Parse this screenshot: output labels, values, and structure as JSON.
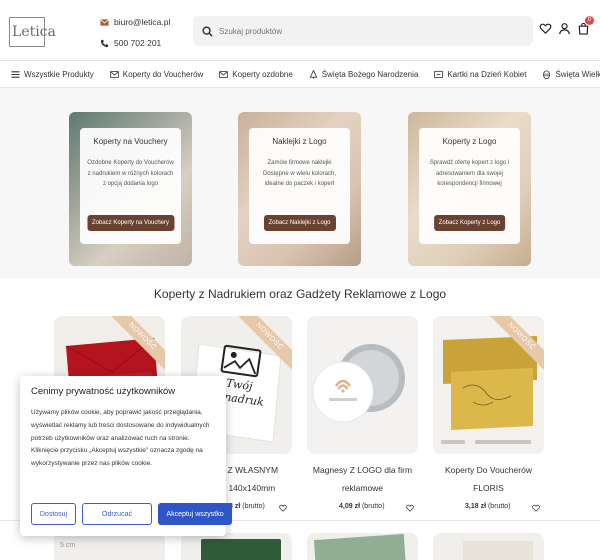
{
  "header": {
    "logo_text": "Letica",
    "email": "biuro@letica.pl",
    "phone": "500 702 201",
    "search_placeholder": "Szukaj produktów",
    "cart_count": "0"
  },
  "nav": {
    "items": [
      {
        "label": "Wszystkie Produkty",
        "icon": "menu-icon"
      },
      {
        "label": "Koperty do Voucherów",
        "icon": "envelope-icon"
      },
      {
        "label": "Koperty ozdobne",
        "icon": "envelope-check-icon"
      },
      {
        "label": "Święta Bożego Narodzenia",
        "icon": "tree-icon"
      },
      {
        "label": "Kartki na Dzień Kobiet",
        "icon": "card-icon"
      },
      {
        "label": "Święta Wielkanocne",
        "icon": "egg-icon"
      }
    ]
  },
  "banners": [
    {
      "title": "Koperty na Vouchery",
      "desc": "Ozdobne Koperty do Voucherów z nadrukiem w różnych kolorach z opcją dodania logo",
      "button": "Zobacz Koperty na Vouchery"
    },
    {
      "title": "Naklejki z Logo",
      "desc": "Zamów firmowe naklejki Dostępne w wielu kolorach, idealne do paczek i kopert",
      "button": "Zobacz Naklejki z Logo"
    },
    {
      "title": "Koperty z Logo",
      "desc": "Sprawdź ofertę kopert z logo i adresowaniem dla swojej korespondencji firmowej",
      "button": "Zobacz Koperty z Logo"
    }
  ],
  "section_title": "Koperty z Nadrukiem oraz Gadżety Reklamowe z Logo",
  "products": [
    {
      "ribbon": "NOWOŚĆ",
      "name_lines": [
        "",
        ""
      ],
      "price": "",
      "unit": ""
    },
    {
      "ribbon": "NOWOŚĆ",
      "image_text": "Twój nadruk",
      "name_lines": [
        "…adycji Z WŁASNYM",
        "…M K4 140x140mm"
      ],
      "price": "…3 zł",
      "unit": "(brutto)"
    },
    {
      "ribbon": "",
      "name_lines": [
        "Magnesy Z LOGO dla firm",
        "reklamowe"
      ],
      "price": "4,09 zł",
      "unit": "(brutto)"
    },
    {
      "ribbon": "NOWOŚĆ",
      "name_lines": [
        "Koperty Do Voucherów",
        "FLORIS"
      ],
      "price": "3,18 zł",
      "unit": "(brutto)"
    }
  ],
  "row2_label": "5 cm",
  "cookie": {
    "title": "Cenimy prywatność użytkowników",
    "text": "Używamy plików cookie, aby poprawić jakość przeglądania, wyświetlać reklamy lub treści dostosowane do indywidualnych potrzeb użytkowników oraz analizować ruch na stronie. Kliknięcie przycisku „Akceptuj wszystkie\" oznacza zgodę na wykorzystywanie przez nas plików cookie.",
    "btn_customize": "Dostosuj",
    "btn_reject": "Odrzucać",
    "btn_accept": "Akceptuj wszystko"
  }
}
